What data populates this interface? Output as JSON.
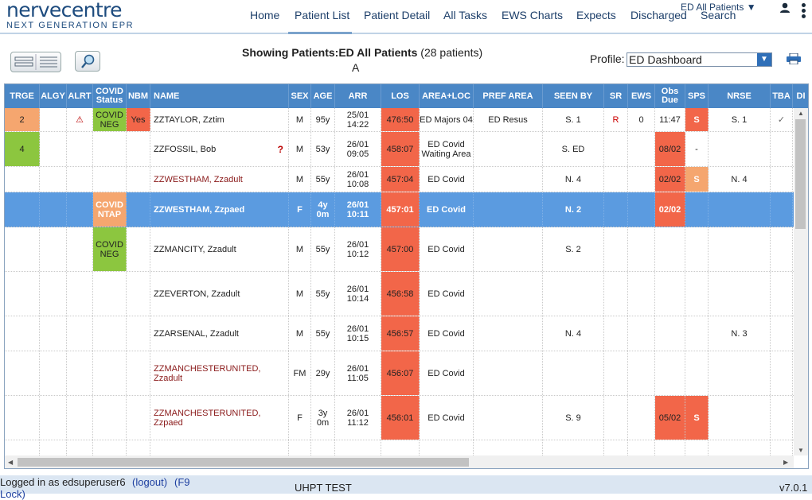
{
  "header": {
    "brand": "nervecentre",
    "tagline": "NEXT GENERATION EPR",
    "nav": [
      "Home",
      "Patient List",
      "Patient Detail",
      "All Tasks",
      "EWS Charts",
      "Expects",
      "Discharged",
      "Search"
    ],
    "active_nav": "Patient List",
    "list_selector": "ED All Patients ▼"
  },
  "toolbar": {
    "showing_prefix": "Showing Patients:",
    "showing_list": "ED All Patients",
    "showing_count": "(28 patients)",
    "sub_letter": "A",
    "profile_label": "Profile:",
    "profile_value": "ED Dashboard"
  },
  "columns": [
    "TRGE",
    "ALGY",
    "ALRT",
    "COVID Status",
    "NBM",
    "NAME",
    "SEX",
    "AGE",
    "ARR",
    "LOS",
    "AREA+LOC",
    "PREF AREA",
    "SEEN BY",
    "SR",
    "EWS",
    "Obs Due",
    "SPS",
    "NRSE",
    "TBA",
    "DI"
  ],
  "rows": [
    {
      "trge": "2",
      "algy": "",
      "alrt": "⚠",
      "covid": "COVID NEG",
      "nbm": "Yes",
      "name": "ZZTAYLOR, Zztim",
      "sex": "M",
      "age": "95y",
      "arr": "25/01 14:22",
      "los": "476:50",
      "area": "ED Majors 04",
      "pref": "ED Resus",
      "seen": "S. 1",
      "sr": "R",
      "ews": "0",
      "obs": "11:47",
      "sps": "S",
      "nrse": "S. 1",
      "tba": "✓"
    },
    {
      "trge": "4",
      "algy": "",
      "alrt": "",
      "covid": "",
      "nbm": "",
      "name": "ZZFOSSIL, Bob",
      "sex": "M",
      "age": "53y",
      "arr": "26/01 09:05",
      "los": "458:07",
      "area": "ED Covid Waiting Area",
      "pref": "",
      "seen": "S. ED",
      "sr": "",
      "ews": "",
      "obs": "08/02",
      "sps": "-",
      "nrse": "",
      "tba": ""
    },
    {
      "trge": "",
      "algy": "",
      "alrt": "",
      "covid": "",
      "nbm": "",
      "name": "ZZWESTHAM, Zzadult",
      "sex": "M",
      "age": "55y",
      "arr": "26/01 10:08",
      "los": "457:04",
      "area": "ED Covid",
      "pref": "",
      "seen": "N. 4",
      "sr": "",
      "ews": "",
      "obs": "02/02",
      "sps": "S",
      "nrse": "N. 4",
      "tba": ""
    },
    {
      "trge": "",
      "algy": "",
      "alrt": "",
      "covid": "COVID NTAP",
      "nbm": "",
      "name": "ZZWESTHAM, Zzpaed",
      "sex": "F",
      "age": "4y 0m",
      "arr": "26/01 10:11",
      "los": "457:01",
      "area": "ED Covid",
      "pref": "",
      "seen": "N. 2",
      "sr": "",
      "ews": "",
      "obs": "02/02",
      "sps": "",
      "nrse": "",
      "tba": ""
    },
    {
      "trge": "",
      "algy": "",
      "alrt": "",
      "covid": "COVID NEG",
      "nbm": "",
      "name": "ZZMANCITY, Zzadult",
      "sex": "M",
      "age": "55y",
      "arr": "26/01 10:12",
      "los": "457:00",
      "area": "ED Covid",
      "pref": "",
      "seen": "S. 2",
      "sr": "",
      "ews": "",
      "obs": "",
      "sps": "",
      "nrse": "",
      "tba": ""
    },
    {
      "trge": "",
      "algy": "",
      "alrt": "",
      "covid": "",
      "nbm": "",
      "name": "ZZEVERTON, Zzadult",
      "sex": "M",
      "age": "55y",
      "arr": "26/01 10:14",
      "los": "456:58",
      "area": "ED Covid",
      "pref": "",
      "seen": "",
      "sr": "",
      "ews": "",
      "obs": "",
      "sps": "",
      "nrse": "",
      "tba": ""
    },
    {
      "trge": "",
      "algy": "",
      "alrt": "",
      "covid": "",
      "nbm": "",
      "name": "ZZARSENAL, Zzadult",
      "sex": "M",
      "age": "55y",
      "arr": "26/01 10:15",
      "los": "456:57",
      "area": "ED Covid",
      "pref": "",
      "seen": "N. 4",
      "sr": "",
      "ews": "",
      "obs": "",
      "sps": "",
      "nrse": "N. 3",
      "tba": ""
    },
    {
      "trge": "",
      "algy": "",
      "alrt": "",
      "covid": "",
      "nbm": "",
      "name": "ZZMANCHESTERUNITED, Zzadult",
      "sex": "FM",
      "age": "29y",
      "arr": "26/01 11:05",
      "los": "456:07",
      "area": "ED Covid",
      "pref": "",
      "seen": "",
      "sr": "",
      "ews": "",
      "obs": "",
      "sps": "",
      "nrse": "",
      "tba": ""
    },
    {
      "trge": "",
      "algy": "",
      "alrt": "",
      "covid": "",
      "nbm": "",
      "name": "ZZMANCHESTERUNITED, Zzpaed",
      "sex": "F",
      "age": "3y 0m",
      "arr": "26/01 11:12",
      "los": "456:01",
      "area": "ED Covid",
      "pref": "",
      "seen": "S. 9",
      "sr": "",
      "ews": "",
      "obs": "05/02",
      "sps": "S",
      "nrse": "",
      "tba": ""
    },
    {
      "trge": "",
      "algy": "",
      "alrt": "",
      "covid": "",
      "nbm": "",
      "name": "",
      "sex": "",
      "age": "",
      "arr": "",
      "los": "",
      "area": "",
      "pref": "",
      "seen": "",
      "sr": "",
      "ews": "",
      "obs": "",
      "sps": "",
      "nrse": "",
      "tba": ""
    }
  ],
  "row2_flag": "?",
  "footer": {
    "logged_in": "Logged in as edsuperuser6",
    "logout": "(logout)",
    "f9": "(F9",
    "lock": "Lock)",
    "site": "UHPT TEST",
    "version": "v7.0.1"
  },
  "colors": {
    "header_blue": "#4a87c6",
    "selected_row": "#5b9be0",
    "los_red": "#f26649",
    "triage_orange": "#f5a66f",
    "triage_green": "#8cc63f",
    "covid_neg": "#8cc63f",
    "covid_ntap": "#f5a66f",
    "nbm_red": "#f26649",
    "sps_red": "#f26649",
    "sps_orange": "#f5a66f"
  }
}
